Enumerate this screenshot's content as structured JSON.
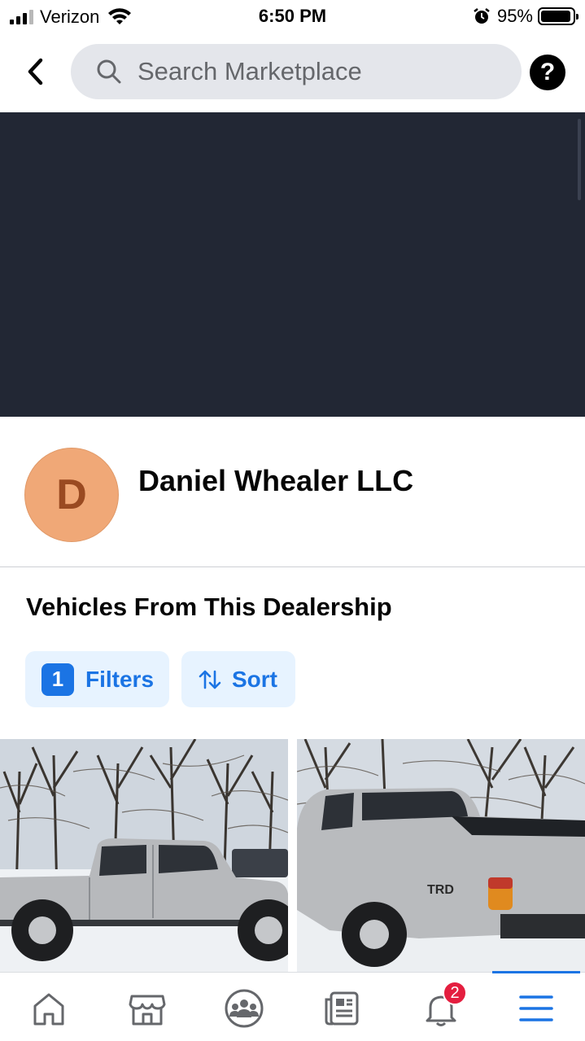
{
  "status_bar": {
    "carrier": "Verizon",
    "time": "6:50 PM",
    "battery_percent": "95%",
    "battery_level": 0.95,
    "signal_bars": 3,
    "signal_bars_total": 4,
    "icons": [
      "signal-icon",
      "wifi-icon",
      "alarm-icon",
      "battery-icon"
    ]
  },
  "header": {
    "search_placeholder": "Search Marketplace",
    "help_label": "?",
    "icons": [
      "back-arrow-icon",
      "search-icon",
      "help-icon"
    ]
  },
  "seller": {
    "avatar_letter": "D",
    "name": "Daniel Whealer LLC",
    "colors": {
      "avatar_bg": "#f0a877",
      "avatar_text": "#9a4a21",
      "cover_bg": "#222734"
    }
  },
  "listings_section": {
    "title": "Vehicles From This Dealership",
    "filters": {
      "count": "1",
      "label": "Filters"
    },
    "sort": {
      "label": "Sort",
      "icon": "sort-arrows-icon"
    },
    "items": [
      {
        "image": "silver pickup truck side view in snow"
      },
      {
        "image": "silver pickup truck rear quarter view in snow"
      }
    ]
  },
  "tabbar": {
    "tabs": [
      {
        "name": "home",
        "icon": "home-icon"
      },
      {
        "name": "marketplace",
        "icon": "marketplace-icon"
      },
      {
        "name": "groups",
        "icon": "groups-icon"
      },
      {
        "name": "news",
        "icon": "news-icon"
      },
      {
        "name": "notifications",
        "icon": "bell-icon",
        "badge": "2"
      },
      {
        "name": "menu",
        "icon": "menu-icon",
        "active": true
      }
    ],
    "colors": {
      "accent": "#1b74e4",
      "badge": "#e41e3f",
      "icon": "#65676b"
    }
  }
}
